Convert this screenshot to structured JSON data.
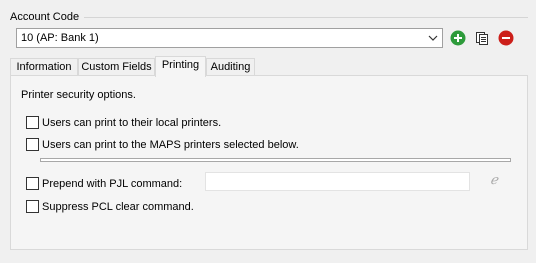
{
  "group": {
    "label": "Account Code"
  },
  "account_select": {
    "value": "10 (AP: Bank 1)"
  },
  "icons": {
    "add": "plus-circle-icon",
    "copy": "copy-document-icon",
    "remove": "minus-circle-icon",
    "add_color": "#2e9b3b",
    "remove_color": "#cc1f1a"
  },
  "tabs": [
    {
      "label": "Information",
      "active": false
    },
    {
      "label": "Custom Fields",
      "active": false
    },
    {
      "label": "Printing",
      "active": true
    },
    {
      "label": "Auditing",
      "active": false
    }
  ],
  "printing": {
    "intro": "Printer security options.",
    "local_printers_label": "Users can print to their local printers.",
    "local_printers_checked": false,
    "maps_printers_label": "Users can print to the MAPS printers selected below.",
    "maps_printers_checked": false,
    "pjl_label": "Prepend with PJL command:",
    "pjl_checked": false,
    "pjl_value": "",
    "suppress_pcl_label": "Suppress PCL clear command.",
    "suppress_pcl_checked": false
  }
}
